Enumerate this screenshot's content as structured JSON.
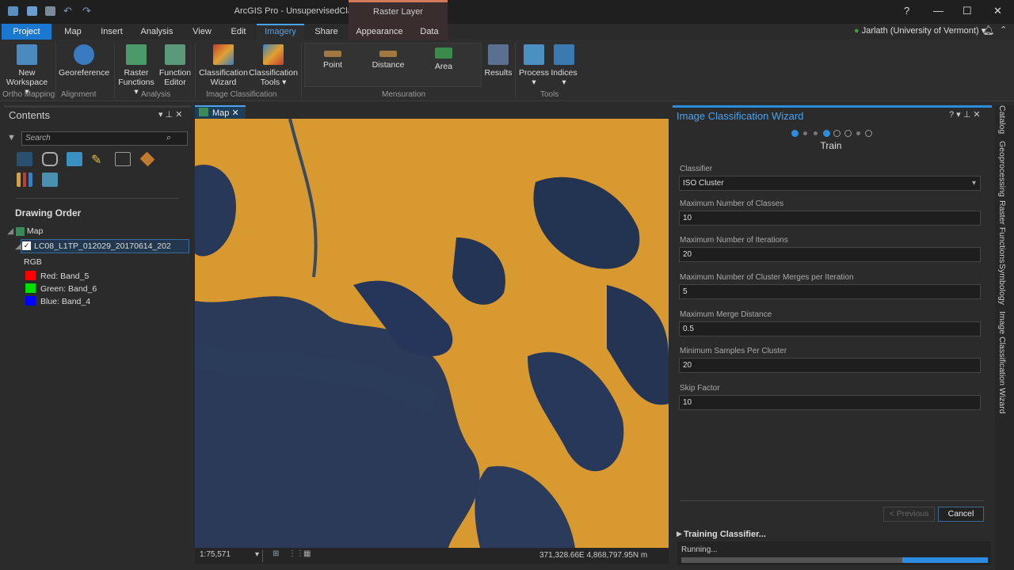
{
  "app": {
    "title": "ArcGIS Pro - UnsupervisedClassification - Map",
    "context_tab": "Raster Layer",
    "user": "Jarlath (University of Vermont)",
    "help": "?"
  },
  "tabs": [
    "Project",
    "Map",
    "Insert",
    "Analysis",
    "View",
    "Edit",
    "Imagery",
    "Share",
    "Appearance",
    "Data"
  ],
  "ribbon": {
    "buttons": [
      "New Workspace",
      "Georeference",
      "Raster Functions",
      "Function Editor",
      "Classification Wizard",
      "Classification Tools",
      "Point",
      "Distance",
      "Area",
      "Results",
      "Process",
      "Indices"
    ],
    "groups": [
      "Ortho Mapping",
      "Alignment",
      "Analysis",
      "Image Classification",
      "Mensuration",
      "Tools"
    ]
  },
  "contents": {
    "title": "Contents",
    "search_placeholder": "Search",
    "heading": "Drawing Order",
    "map": "Map",
    "layer": "LC08_L1TP_012029_20170614_202",
    "rgb": "RGB",
    "bands": [
      {
        "label": "Red:",
        "value": "Band_5",
        "color": "#ff0000"
      },
      {
        "label": "Green:",
        "value": "Band_6",
        "color": "#00e000"
      },
      {
        "label": "Blue:",
        "value": "Band_4",
        "color": "#0000ff"
      }
    ]
  },
  "map": {
    "tab": "Map",
    "scale": "1:75,571",
    "coords": "371,328.66E 4,868,797.95N m"
  },
  "wizard": {
    "title": "Image Classification Wizard",
    "step": "Train",
    "current_step": 4,
    "total_steps": 8,
    "fields": [
      {
        "label": "Classifier",
        "value": "ISO Cluster"
      },
      {
        "label": "Maximum Number of Classes",
        "value": "10"
      },
      {
        "label": "Maximum Number of Iterations",
        "value": "20"
      },
      {
        "label": "Maximum Number of Cluster Merges per Iteration",
        "value": "5"
      },
      {
        "label": "Maximum Merge Distance",
        "value": "0.5"
      },
      {
        "label": "Minimum Samples Per Cluster",
        "value": "20"
      },
      {
        "label": "Skip Factor",
        "value": "10"
      }
    ],
    "previous": "< Previous",
    "cancel": "Cancel",
    "progress_title": "Training Classifier...",
    "progress_status": "Running...",
    "progress_percent": 72
  },
  "side_tabs": [
    "Catalog",
    "Geoprocessing",
    "Raster Functions",
    "Symbology",
    "Image Classification Wizard"
  ]
}
